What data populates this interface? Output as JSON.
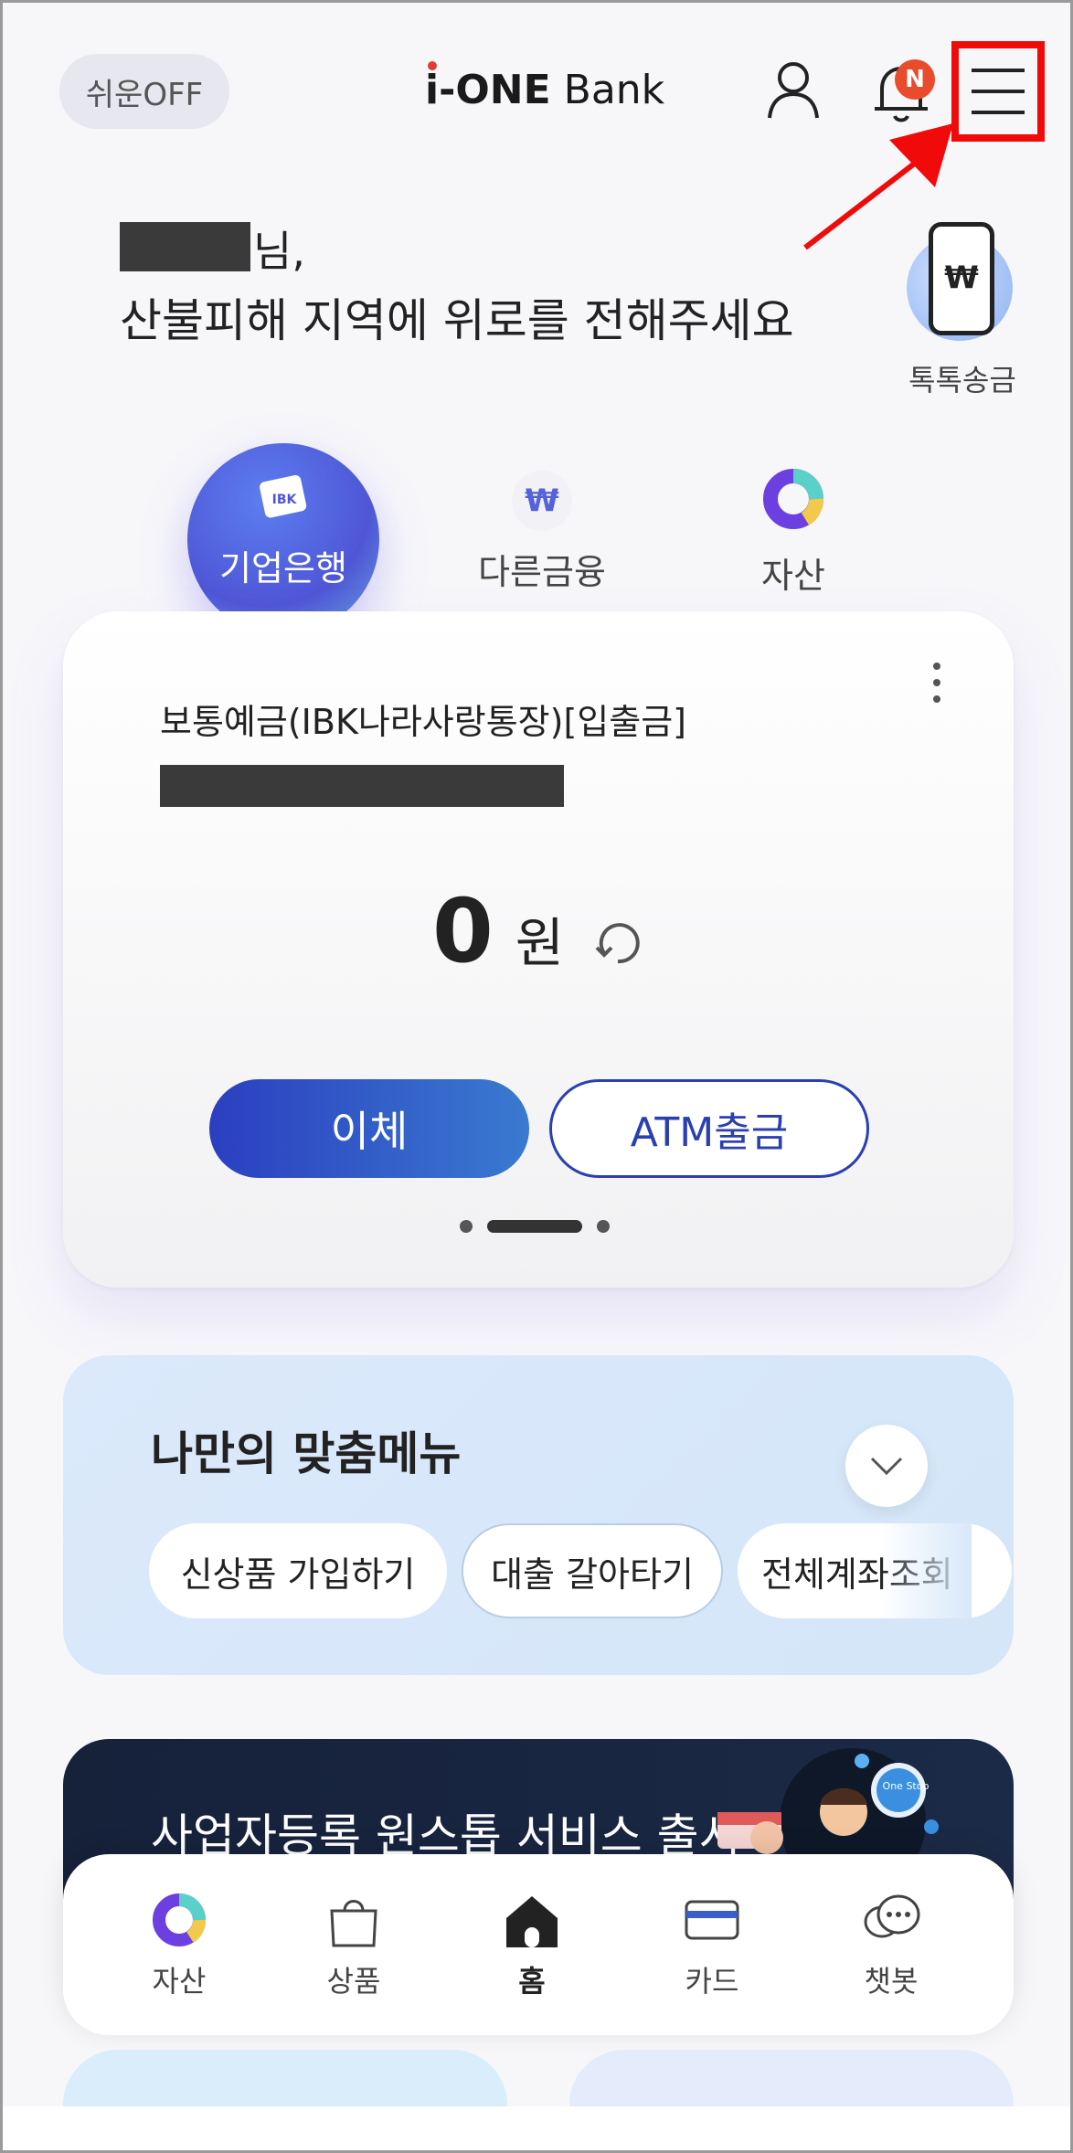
{
  "header": {
    "easy_toggle_label": "쉬운OFF",
    "logo_prefix": "i-ONE",
    "logo_suffix": "Bank",
    "notification_badge": "N"
  },
  "greeting": {
    "name_suffix": "님,",
    "message": "산불피해 지역에 위로를 전해주세요",
    "quick_action_label": "톡톡송금",
    "quick_action_symbol": "₩"
  },
  "tabs": [
    {
      "label": "기업은행",
      "active": true
    },
    {
      "label": "다른금융",
      "active": false
    },
    {
      "label": "자산",
      "active": false
    }
  ],
  "account": {
    "name": "보통예금(IBK나라사랑통장)[입출금]",
    "balance": "0",
    "currency_unit": "원",
    "transfer_label": "이체",
    "atm_label": "ATM출금",
    "page_index": 2,
    "page_count": 3
  },
  "my_menu": {
    "title": "나만의 맞춤메뉴",
    "chips": [
      "신상품 가입하기",
      "대출 갈아타기",
      "전체계좌조회"
    ]
  },
  "banner": {
    "title": "사업자등록 원스톱 서비스 출시",
    "badge": "One Stop"
  },
  "bottom_nav": [
    {
      "label": "자산"
    },
    {
      "label": "상품"
    },
    {
      "label": "홈"
    },
    {
      "label": "카드"
    },
    {
      "label": "챗봇"
    }
  ],
  "colors": {
    "accent": "#4f56d6",
    "highlight": "#f00a0a",
    "badge": "#e84c2c"
  }
}
